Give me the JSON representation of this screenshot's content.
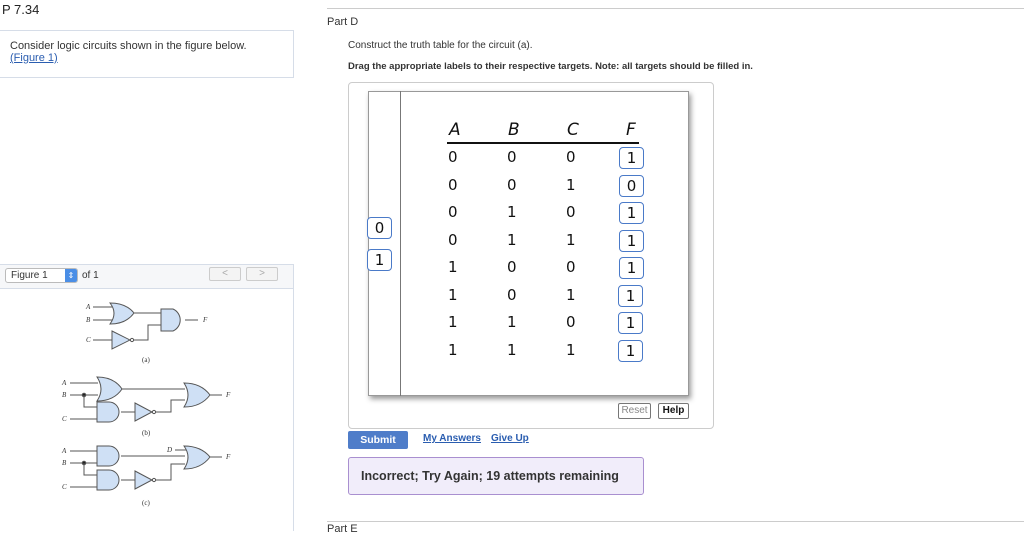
{
  "problem_title": "P 7.34",
  "left": {
    "intro": "Consider logic circuits shown in the figure below.",
    "figure_link": "(Figure 1)",
    "figure_select": "Figure 1",
    "figure_of": "of 1",
    "prev": "<",
    "next": ">",
    "captions": [
      "(a)",
      "(b)",
      "(c)"
    ],
    "labels": {
      "A": "A",
      "B": "B",
      "C": "C",
      "D": "D",
      "F": "F"
    }
  },
  "part": {
    "title": "Part D",
    "instruction": "Construct the truth table for the circuit (a).",
    "drag_note": "Drag the appropriate labels to their respective targets. Note: all targets should be filled in.",
    "label_bank": [
      "0",
      "1"
    ],
    "headers": [
      "A",
      "B",
      "C",
      "F"
    ],
    "rows": [
      [
        "0",
        "0",
        "0",
        "1"
      ],
      [
        "0",
        "0",
        "1",
        "0"
      ],
      [
        "0",
        "1",
        "0",
        "1"
      ],
      [
        "0",
        "1",
        "1",
        "1"
      ],
      [
        "1",
        "0",
        "0",
        "1"
      ],
      [
        "1",
        "0",
        "1",
        "1"
      ],
      [
        "1",
        "1",
        "0",
        "1"
      ],
      [
        "1",
        "1",
        "1",
        "1"
      ]
    ],
    "reset": "Reset",
    "help": "Help",
    "submit": "Submit",
    "my_answers": "My Answers",
    "give_up": "Give Up",
    "feedback": "Incorrect; Try Again; 19 attempts remaining"
  },
  "next_part": "Part E"
}
